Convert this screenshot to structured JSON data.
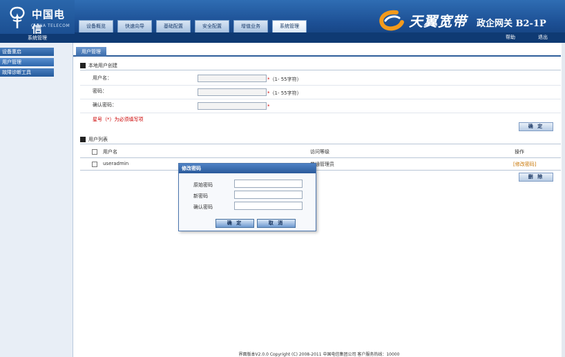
{
  "header": {
    "logo_cn": "中国电信",
    "logo_en": "CHINA TELECOM",
    "logo_sub": "系统管理",
    "nav_tabs": [
      "设备概览",
      "快速向导",
      "基础配置",
      "安全配置",
      "增值业务",
      "系统管理"
    ],
    "brand_text": "天翼宽带",
    "brand_model": "政企网关 B2-1P",
    "help": "帮助",
    "logout": "退出"
  },
  "sidebar": {
    "items": [
      "设备重启",
      "用户管理",
      "故障诊断工具"
    ]
  },
  "main": {
    "sub_tab": "用户管理",
    "create_section": "本地用户创建",
    "username_label": "用户名：",
    "password_label": "密码：",
    "confirm_label": "确认密码：",
    "hint_length": "（1- 55字符）",
    "required_star": "*",
    "required_note": "星号（*）为必须填写项",
    "confirm_button": "确 定",
    "list_section": "用户列表",
    "col_username": "用户名",
    "col_level": "访问等级",
    "col_action": "操作",
    "delete_button": "删 除"
  },
  "user_list": {
    "rows": [
      {
        "username": "useradmin",
        "level": "普通管理员",
        "action": "[修改密码]"
      }
    ]
  },
  "modal": {
    "title": "修改密码",
    "old_pwd": "原始密码",
    "new_pwd": "新密码",
    "confirm_pwd": "确认密码",
    "ok": "确 定",
    "cancel": "取 消"
  },
  "footer": {
    "text": "界面版本V2.0.0 Copyright (C) 2008-2011 中国电信集团公司 客户服务热线：10000"
  },
  "colors": {
    "header_blue": "#1c4f94",
    "required_red": "#cc0000",
    "link_orange": "#c87400"
  }
}
